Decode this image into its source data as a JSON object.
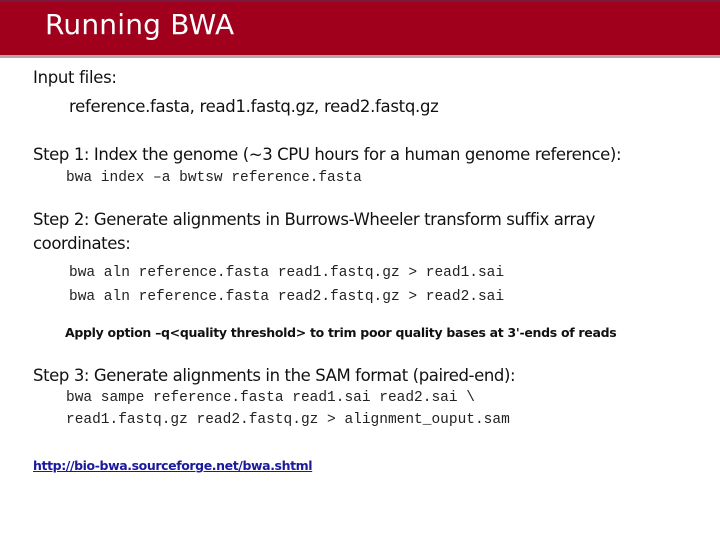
{
  "slide": {
    "title": "Running BWA",
    "colors": {
      "title_bar": "#a0001c",
      "title_text": "#ffffff",
      "link": "#1a1a9c"
    }
  },
  "input_section": {
    "heading": "Input files:",
    "files": "reference.fasta, read1.fastq.gz, read2.fastq.gz"
  },
  "step1": {
    "heading": "Step 1: Index the genome (~3 CPU hours for a human genome reference):",
    "commands": [
      "bwa index –a bwtsw reference.fasta"
    ]
  },
  "step2": {
    "heading_line1": "Step 2: Generate alignments in Burrows-Wheeler transform suffix array",
    "heading_line2": "coordinates:",
    "commands": [
      "bwa aln reference.fasta read1.fastq.gz > read1.sai",
      "bwa aln reference.fasta read2.fastq.gz > read2.sai"
    ],
    "note": "Apply option –q<quality threshold>  to trim poor quality bases at 3'-ends of reads"
  },
  "step3": {
    "heading": "Step 3: Generate alignments in the SAM format (paired-end):",
    "commands": [
      "bwa sampe reference.fasta read1.sai read2.sai \\",
      "read1.fastq.gz read2.fastq.gz > alignment_ouput.sam"
    ]
  },
  "reference_link": {
    "text": "http://bio-bwa.sourceforge.net/bwa.shtml"
  }
}
